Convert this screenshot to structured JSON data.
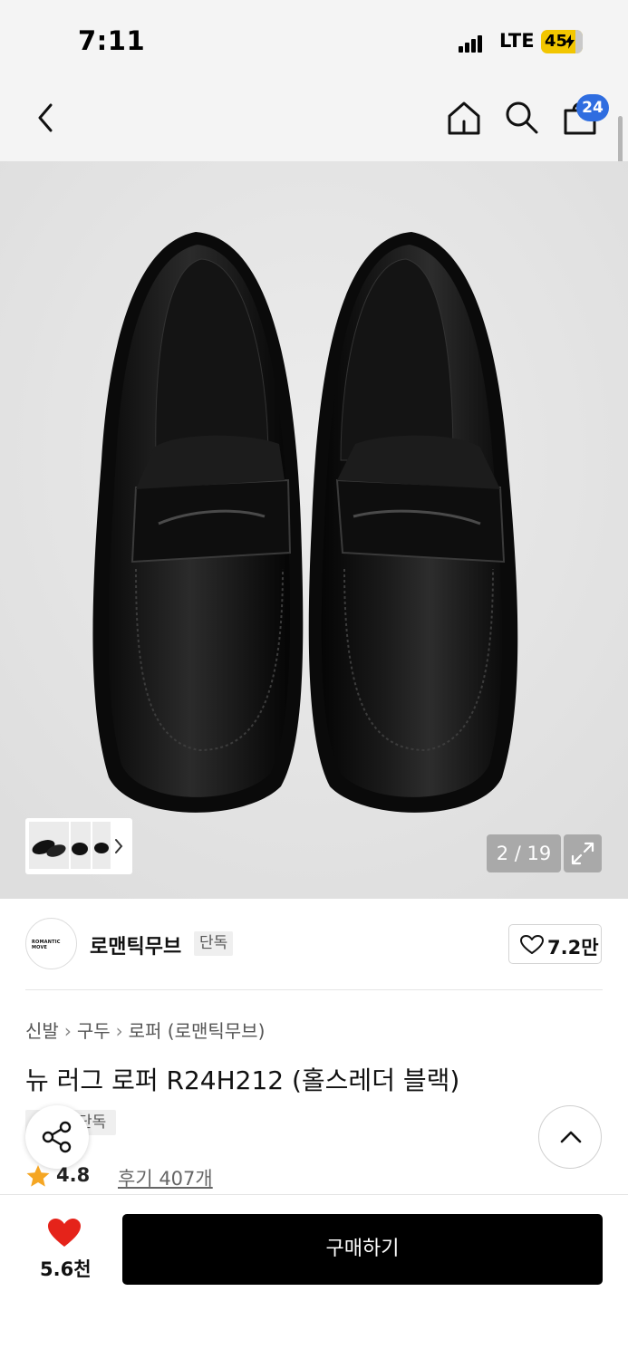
{
  "status_bar": {
    "time": "7:11",
    "network": "LTE",
    "battery": "45"
  },
  "nav": {
    "cart_count": "24"
  },
  "gallery": {
    "counter": "2 / 19"
  },
  "brand": {
    "name": "로맨틱무브",
    "logo_text": "ROMANTIC MOVE",
    "tag": "단독",
    "like_count": "7.2만"
  },
  "breadcrumb": [
    "신발",
    "구두",
    "로퍼 (로맨틱무브)"
  ],
  "product": {
    "title": "뉴 러그 로퍼 R24H212 (홀스레더 블랙)",
    "exclusive_tag": "단독",
    "rating": "4.8",
    "reviews": "후기 407개"
  },
  "bottom_bar": {
    "wish_count": "5.6천",
    "buy_label": "구매하기"
  },
  "colors": {
    "accent_badge": "#2f6de0",
    "battery": "#f2c600",
    "wish_heart": "#e5231a",
    "star": "#f5a623",
    "buy_button": "#000000"
  }
}
